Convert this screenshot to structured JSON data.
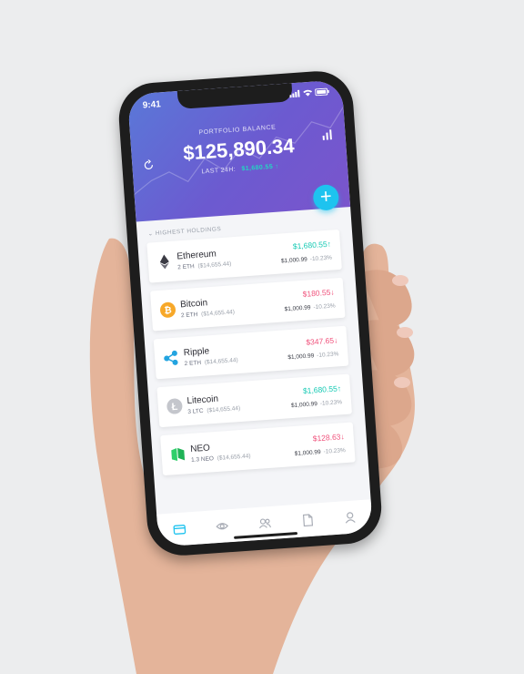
{
  "status": {
    "time": "9:41"
  },
  "header": {
    "balance_label": "PORTFOLIO BALANCE",
    "balance": "$125,890.34",
    "last24_label": "LAST 24H:",
    "last24_change": "$1,680.55 ↑"
  },
  "section_title": "⌄ HIGHEST HOLDINGS",
  "colors": {
    "accent": "#1ec3ef",
    "up": "#13c9b3",
    "down": "#f0517b",
    "header_start": "#5a78d8",
    "header_end": "#7a55cc"
  },
  "holdings": [
    {
      "name": "Ethereum",
      "amount": "2 ETH",
      "usd": "($14,655.44)",
      "change": "$1,680.55",
      "arrow": "↑",
      "direction": "up",
      "price": "$1,000.99",
      "pct": "-10.23%",
      "icon": "ethereum-icon"
    },
    {
      "name": "Bitcoin",
      "amount": "2 ETH",
      "usd": "($14,655.44)",
      "change": "$180.55",
      "arrow": "↓",
      "direction": "down",
      "price": "$1,000.99",
      "pct": "-10.23%",
      "icon": "bitcoin-icon"
    },
    {
      "name": "Ripple",
      "amount": "2 ETH",
      "usd": "($14,655.44)",
      "change": "$347.65",
      "arrow": "↓",
      "direction": "down",
      "price": "$1,000.99",
      "pct": "-10.23%",
      "icon": "ripple-icon"
    },
    {
      "name": "Litecoin",
      "amount": "3 LTC",
      "usd": "($14,655.44)",
      "change": "$1,680.55",
      "arrow": "↑",
      "direction": "up",
      "price": "$1,000.99",
      "pct": "-10.23%",
      "icon": "litecoin-icon"
    },
    {
      "name": "NEO",
      "amount": "1.3 NEO",
      "usd": "($14,655.44)",
      "change": "$128.63",
      "arrow": "↓",
      "direction": "down",
      "price": "$1,000.99",
      "pct": "-10.23%",
      "icon": "neo-icon"
    }
  ],
  "tabs": [
    {
      "icon": "wallet-icon",
      "active": true
    },
    {
      "icon": "eye-icon",
      "active": false
    },
    {
      "icon": "users-icon",
      "active": false
    },
    {
      "icon": "document-icon",
      "active": false
    },
    {
      "icon": "profile-icon",
      "active": false
    }
  ]
}
